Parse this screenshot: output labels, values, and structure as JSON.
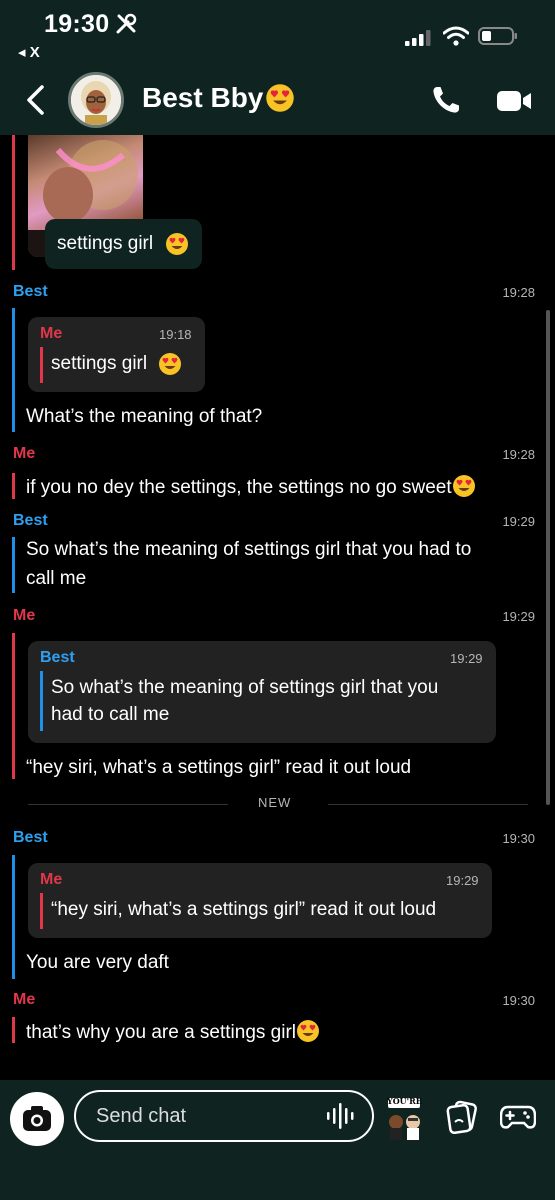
{
  "status_bar": {
    "time": "19:30",
    "back_app": "◂ X"
  },
  "header": {
    "title": "Best Bby",
    "title_emoji": "heart-eyes-emoji",
    "icons": [
      "back-chevron-icon",
      "phone-icon",
      "video-camera-icon"
    ]
  },
  "messages": {
    "first": {
      "text": "settings girl"
    },
    "m1": {
      "sender": "Best",
      "time": "19:28",
      "quote_sender": "Me",
      "quote_time": "19:18",
      "quote_text": "settings girl",
      "text": "What’s the meaning of that?"
    },
    "m2": {
      "sender": "Me",
      "time": "19:28",
      "text": "if you no dey the settings, the settings no go sweet"
    },
    "m3": {
      "sender": "Best",
      "time": "19:29",
      "text_line1": "So what’s the meaning of settings girl that you had to",
      "text_line2": "call me"
    },
    "m4": {
      "sender": "Me",
      "time": "19:29",
      "quote_sender": "Best",
      "quote_time": "19:29",
      "quote_line1": "So what’s the meaning of settings girl that you",
      "quote_line2": "had to call me",
      "text": "“hey siri, what’s a settings girl” read it out loud"
    },
    "divider": "NEW",
    "m5": {
      "sender": "Best",
      "time": "19:30",
      "quote_sender": "Me",
      "quote_time": "19:29",
      "quote_text": "“hey siri, what’s a settings girl” read it out loud",
      "text": "You are very daft"
    },
    "m6": {
      "sender": "Me",
      "time": "19:30",
      "text": "that’s why you are a settings girl"
    }
  },
  "composer": {
    "placeholder": "Send chat",
    "bitmoji_label": "YOU'RE"
  },
  "colors": {
    "header_bg": "#0f2420",
    "me_accent": "#e0374b",
    "best_accent": "#2ea0f0",
    "quote_bg": "#222222"
  }
}
